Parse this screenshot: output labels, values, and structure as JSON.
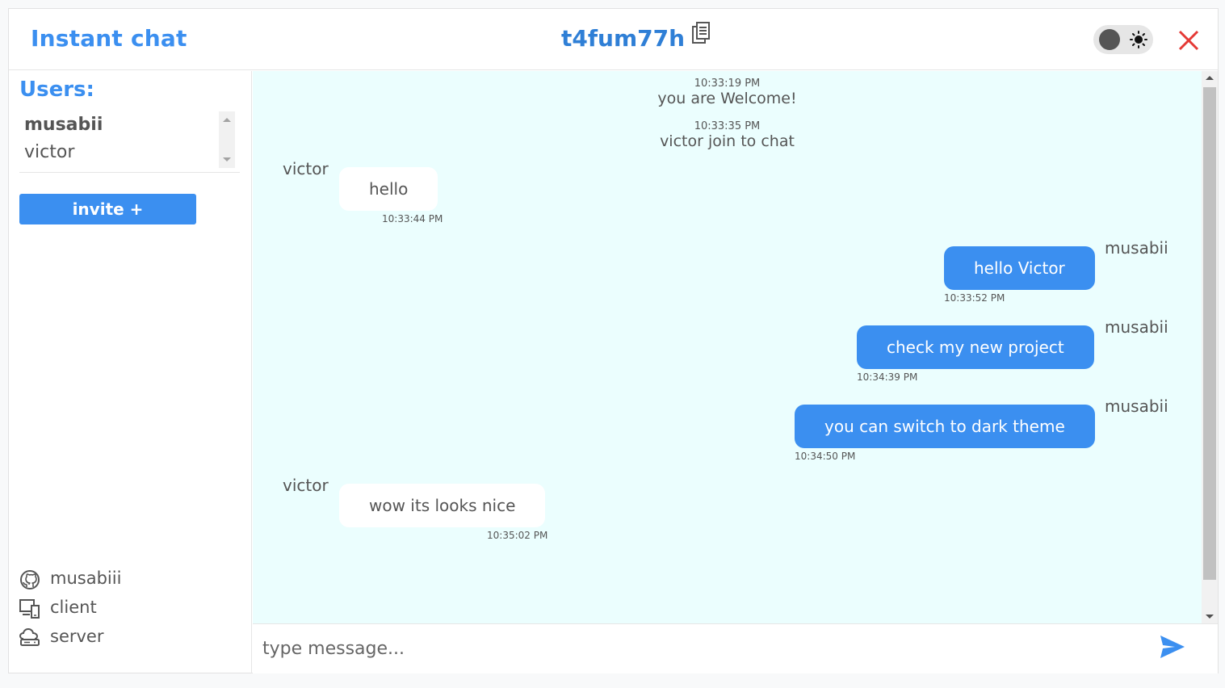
{
  "header": {
    "app_title": "Instant chat",
    "room_id": "t4fum77h"
  },
  "sidebar": {
    "users_title": "Users:",
    "users": [
      "musabii",
      "victor"
    ],
    "invite_label": "invite +",
    "links": [
      {
        "label": "musabiii",
        "icon": "github-icon"
      },
      {
        "label": "client",
        "icon": "devices-icon"
      },
      {
        "label": "server",
        "icon": "cloud-server-icon"
      }
    ]
  },
  "messages": {
    "system": [
      {
        "time": "10:33:19 PM",
        "text": "you are Welcome!"
      },
      {
        "time": "10:33:35 PM",
        "text": "victor join to chat"
      }
    ],
    "chat": [
      {
        "sender": "victor",
        "text": "hello",
        "time": "10:33:44 PM",
        "direction": "in"
      },
      {
        "sender": "musabii",
        "text": "hello Victor",
        "time": "10:33:52 PM",
        "direction": "out"
      },
      {
        "sender": "musabii",
        "text": "check my new project",
        "time": "10:34:39 PM",
        "direction": "out"
      },
      {
        "sender": "musabii",
        "text": "you can switch to dark theme",
        "time": "10:34:50 PM",
        "direction": "out"
      },
      {
        "sender": "victor",
        "text": "wow its looks nice",
        "time": "10:35:02 PM",
        "direction": "in"
      }
    ]
  },
  "composer": {
    "placeholder": "type message..."
  },
  "colors": {
    "accent": "#3b8ff0",
    "chat_background": "#ebfefe",
    "close": "#e53935"
  }
}
